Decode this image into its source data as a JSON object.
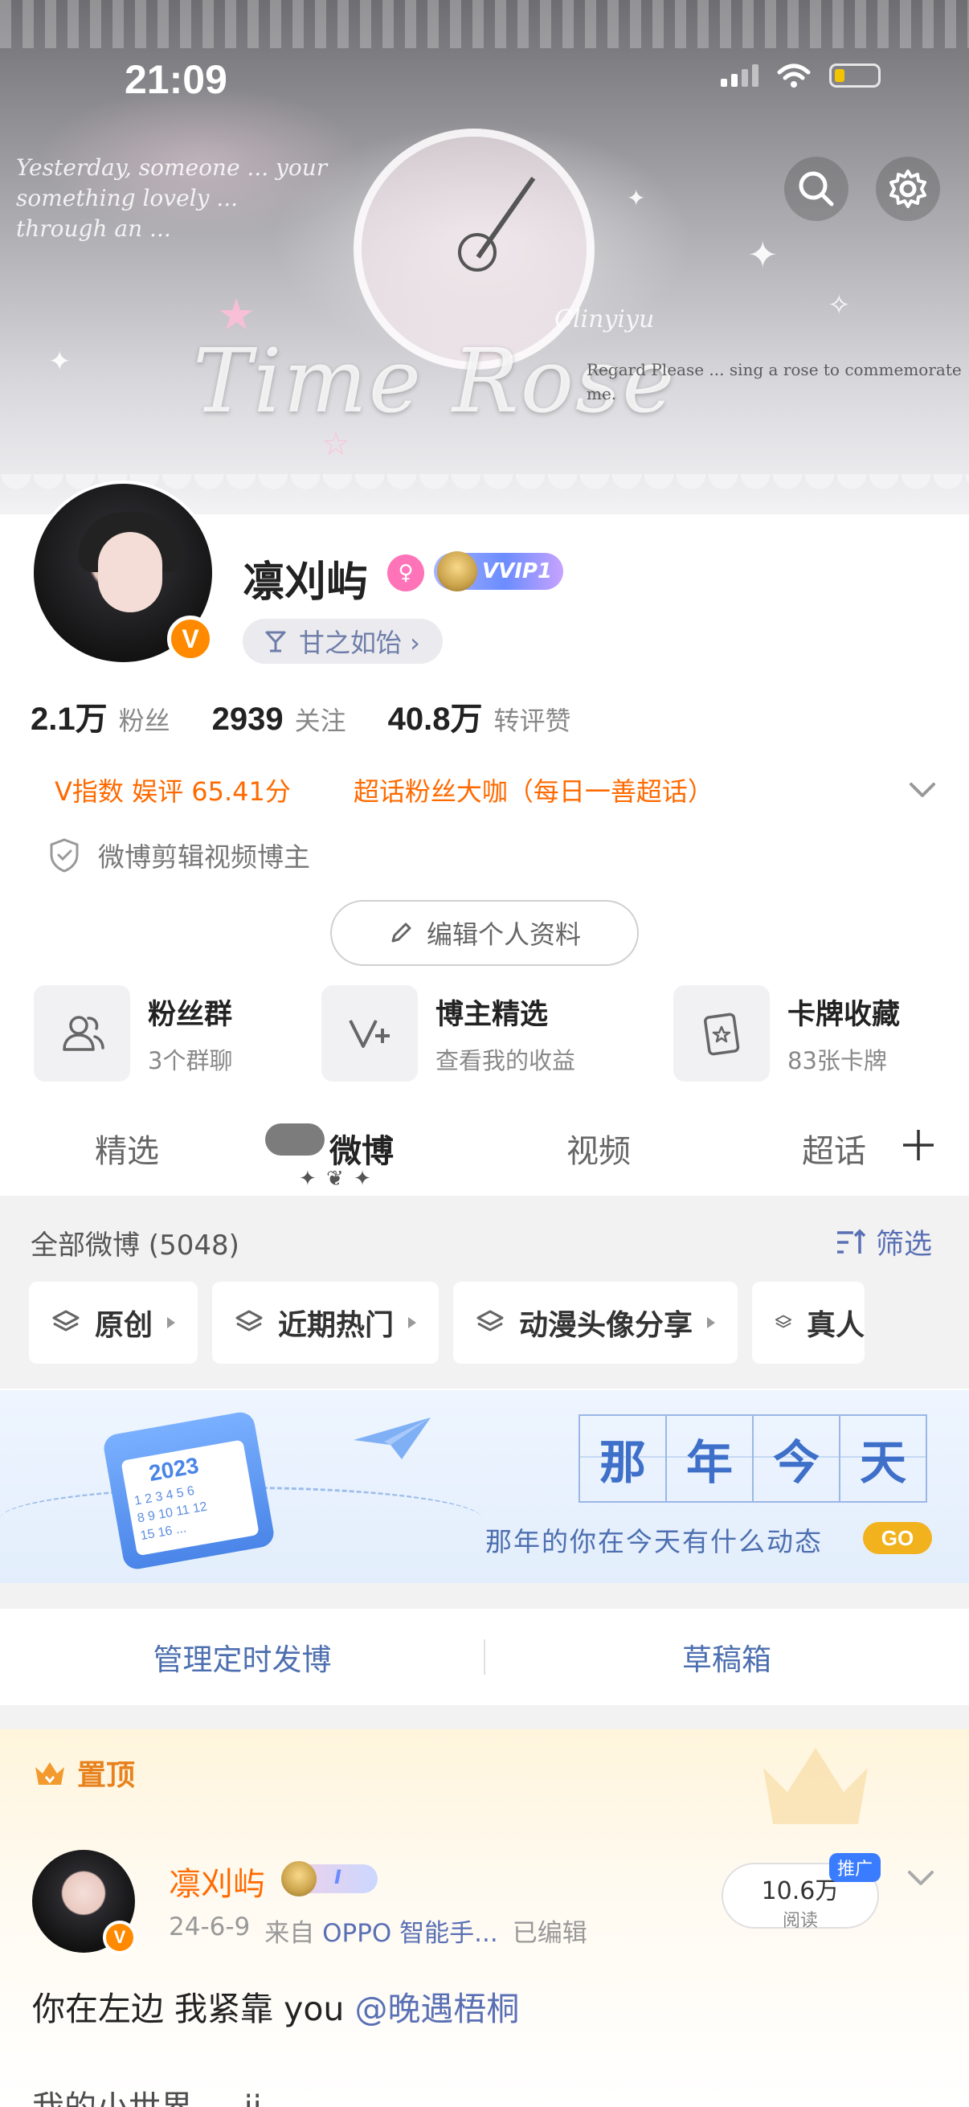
{
  "status_bar": {
    "time": "21:09"
  },
  "banner": {
    "script_title": "Time Rose",
    "signature": "Clinyiyu",
    "small_text": "Regard    Please ... sing a rose to commemorate me.",
    "scrawl": "Yesterday, someone ... your\nsomething lovely ...\nthrough an ..."
  },
  "profile": {
    "username": "凛刈屿",
    "vip_badge": "VVIP1",
    "medal_label": "甘之如饴 ›",
    "v_mark": "V",
    "stats": [
      {
        "num": "2.1万",
        "label": "粉丝"
      },
      {
        "num": "2939",
        "label": "关注"
      },
      {
        "num": "40.8万",
        "label": "转评赞"
      }
    ],
    "chips": [
      "V指数 娱评 65.41分",
      "超话粉丝大咖（每日一善超话）"
    ],
    "verification": "微博剪辑视频博主",
    "edit_button": "编辑个人资料"
  },
  "quick_entries": [
    {
      "title": "粉丝群",
      "sub": "3个群聊",
      "icon": "people-icon"
    },
    {
      "title": "博主精选",
      "sub": "查看我的收益",
      "icon": "v-plus-icon"
    },
    {
      "title": "卡牌收藏",
      "sub": "83张卡牌",
      "icon": "card-icon"
    }
  ],
  "tabs": [
    "精选",
    "微博",
    "视频",
    "超话"
  ],
  "active_tab": "微博",
  "posts_header": {
    "all_label": "全部微博 (5048)",
    "filter_label": "筛选"
  },
  "categories": [
    "原创",
    "近期热门",
    "动漫头像分享",
    "真人"
  ],
  "promo": {
    "calendar_year": "2023",
    "calendar_days": "1 2 3 4 5 6\n8 9 10 11 12\n15 16 ...",
    "title_chars": [
      "那",
      "年",
      "今",
      "天"
    ],
    "subtitle": "那年的你在今天有什么动态",
    "go_label": "GO"
  },
  "actions": [
    "管理定时发博",
    "草稿箱"
  ],
  "pinned": {
    "label": "置顶",
    "author": "凛刈屿",
    "badge_text": "I",
    "date": "24-6-9",
    "source_prefix": "来自",
    "source": "OPPO 智能手...",
    "edited": "已编辑",
    "reads_num": "10.6万",
    "reads_label": "阅读",
    "promo_tag": "推广",
    "text": "你在左边 我紧靠 you ",
    "mention": "@晚遇梧桐",
    "next_line": "我的小世界 ... ii ..."
  },
  "colors": {
    "accent_orange": "#ff6a00",
    "link_blue": "#5a70b5",
    "go_yellow": "#f2b21d",
    "v_orange": "#ff8a00"
  }
}
